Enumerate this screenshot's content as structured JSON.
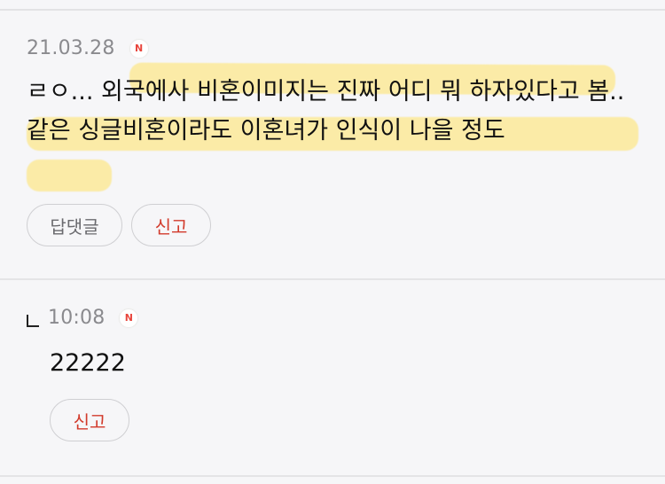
{
  "comments": [
    {
      "date": "21.03.28",
      "badge": "N",
      "text": "ㄹㅇ... 외국에사 비혼이미지는 진짜 어디 뭐 하자있다고 봄.. 같은 싱글비혼이라도 이혼녀가 인식이 나을 정도",
      "reply_label": "답댓글",
      "report_label": "신고"
    },
    {
      "time": "10:08",
      "badge": "N",
      "text": "22222",
      "report_label": "신고"
    }
  ],
  "colors": {
    "highlight": "#ffe164",
    "report_text": "#d23a2b",
    "badge_red": "#e8453c"
  }
}
